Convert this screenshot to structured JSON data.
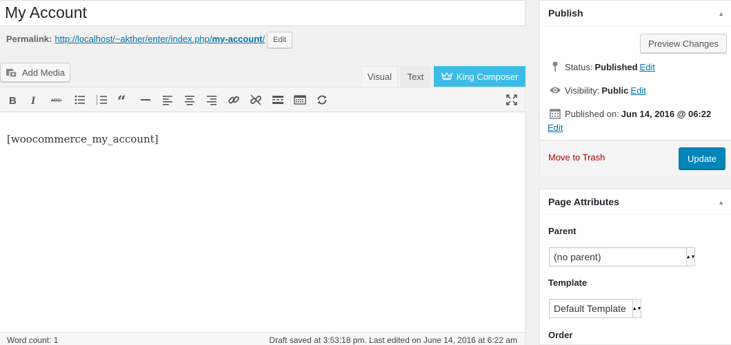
{
  "title": "My Account",
  "permalink": {
    "label": "Permalink:",
    "url_base": "http://localhost/~akther/enter/index.php/",
    "slug": "my-account",
    "url_end": "/",
    "edit_label": "Edit"
  },
  "media": {
    "add_label": "Add Media"
  },
  "tabs": {
    "visual": "Visual",
    "text": "Text",
    "king_composer": "King Composer"
  },
  "toolbar_icons": [
    "bold-icon",
    "italic-icon",
    "strikethrough-icon",
    "bullet-list-icon",
    "numbered-list-icon",
    "blockquote-icon",
    "horizontal-line-icon",
    "align-left-icon",
    "align-center-icon",
    "align-right-icon",
    "link-icon",
    "unlink-icon",
    "read-more-icon",
    "toolbar-toggle-icon",
    "refresh-icon",
    "fullscreen-icon"
  ],
  "editor": {
    "content": "[woocommerce_my_account]",
    "word_count": "Word count: 1",
    "draft_status": "Draft saved at 3:53:18 pm. Last edited on June 14, 2016 at 6:22 am"
  },
  "publish": {
    "heading": "Publish",
    "preview_label": "Preview Changes",
    "status_label": "Status:",
    "status_value": "Published",
    "visibility_label": "Visibility:",
    "visibility_value": "Public",
    "published_label": "Published on:",
    "published_value": "Jun 14, 2016 @ 06:22",
    "edit_label": "Edit",
    "trash_label": "Move to Trash",
    "update_label": "Update"
  },
  "page_attributes": {
    "heading": "Page Attributes",
    "parent_label": "Parent",
    "parent_value": "(no parent)",
    "template_label": "Template",
    "template_value": "Default Template",
    "order_label": "Order"
  },
  "colors": {
    "accent": "#0073aa",
    "update_button": "#0085ba",
    "king_composer": "#3ebce8",
    "trash": "#aa0000"
  }
}
